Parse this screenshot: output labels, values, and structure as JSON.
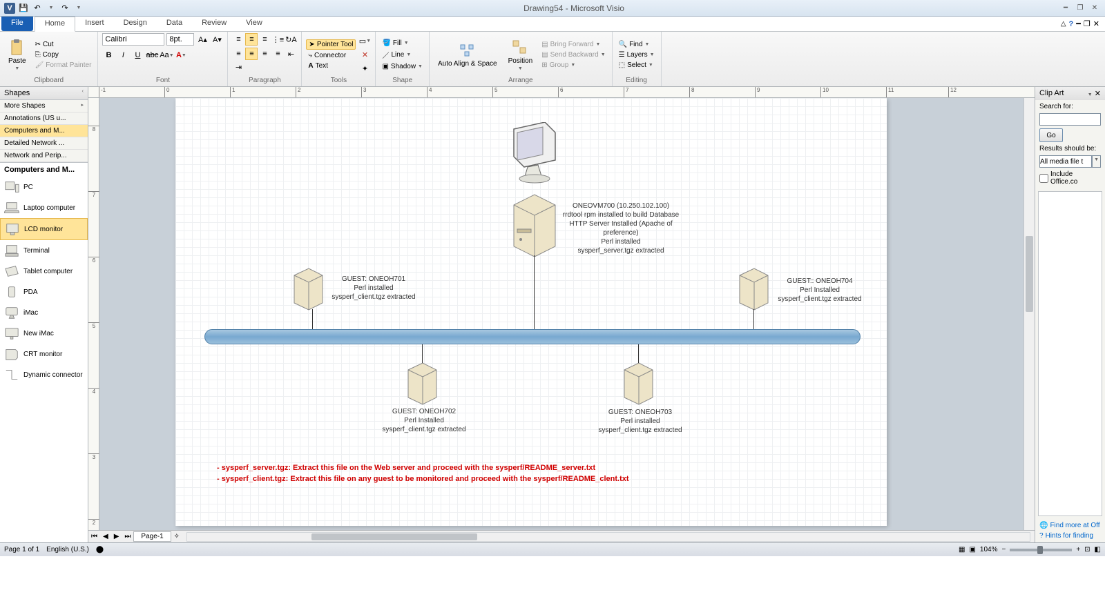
{
  "title": "Drawing54 - Microsoft Visio",
  "tabs": {
    "file": "File",
    "home": "Home",
    "insert": "Insert",
    "design": "Design",
    "data": "Data",
    "review": "Review",
    "view": "View"
  },
  "ribbon": {
    "clipboard": {
      "label": "Clipboard",
      "paste": "Paste",
      "cut": "Cut",
      "copy": "Copy",
      "format_painter": "Format Painter"
    },
    "font": {
      "label": "Font",
      "name": "Calibri",
      "size": "8pt."
    },
    "paragraph": {
      "label": "Paragraph"
    },
    "tools": {
      "label": "Tools",
      "pointer": "Pointer Tool",
      "connector": "Connector",
      "text": "Text"
    },
    "shape": {
      "label": "Shape",
      "fill": "Fill",
      "line": "Line",
      "shadow": "Shadow"
    },
    "arrange": {
      "label": "Arrange",
      "autoalign": "Auto Align & Space",
      "position": "Position",
      "forward": "Bring Forward",
      "backward": "Send Backward",
      "group": "Group"
    },
    "editing": {
      "label": "Editing",
      "find": "Find",
      "layers": "Layers",
      "select": "Select"
    }
  },
  "shapes": {
    "title": "Shapes",
    "more": "More Shapes",
    "stencils": [
      "Annotations (US u...",
      "Computers and M...",
      "Detailed Network ...",
      "Network and Perip..."
    ],
    "current_stencil": "Computers and M...",
    "items": [
      "PC",
      "Laptop computer",
      "LCD monitor",
      "Terminal",
      "Tablet computer",
      "PDA",
      "iMac",
      "New iMac",
      "CRT monitor",
      "Dynamic connector"
    ]
  },
  "diagram": {
    "server_main": {
      "l1": "ONEOVM700 (10.250.102.100)",
      "l2": "rrdtool rpm installed to build Database",
      "l3": "HTTP Server Installed (Apache of preference)",
      "l4": "Perl installed",
      "l5": "sysperf_server.tgz extracted"
    },
    "g701": {
      "l1": "GUEST: ONEOH701",
      "l2": "Perl installed",
      "l3": "sysperf_client.tgz extracted"
    },
    "g702": {
      "l1": "GUEST: ONEOH702",
      "l2": "Perl Installed",
      "l3": "sysperf_client.tgz extracted"
    },
    "g703": {
      "l1": "GUEST: ONEOH703",
      "l2": "Perl installed",
      "l3": "sysperf_client.tgz extracted"
    },
    "g704": {
      "l1": "GUEST:: ONEOH704",
      "l2": "Perl Installed",
      "l3": "sysperf_client.tgz extracted"
    },
    "note1": "- sysperf_server.tgz: Extract this file on the Web server and proceed with the sysperf/README_server.txt",
    "note2": "- sysperf_client.tgz: Extract this file on any guest to be monitored and proceed with the   sysperf/README_clent.txt"
  },
  "clipart": {
    "title": "Clip Art",
    "search_for": "Search for:",
    "go": "Go",
    "results_label": "Results should be:",
    "results_value": "All media file t",
    "include": "Include Office.co",
    "find_more": "Find more at Off",
    "hints": "Hints for finding"
  },
  "pagetab": "Page-1",
  "status": {
    "page": "Page 1 of 1",
    "lang": "English (U.S.)",
    "zoom": "104%"
  }
}
